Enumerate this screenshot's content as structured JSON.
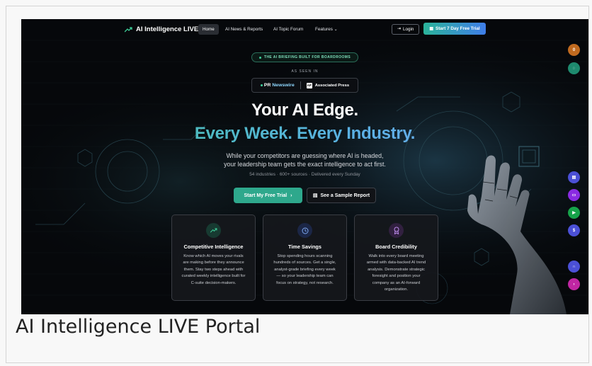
{
  "caption": "AI Intelligence LIVE Portal",
  "nav": {
    "logo": "AI Intelligence LIVE",
    "links": [
      "Home",
      "AI News & Reports",
      "AI Topic Forum",
      "Features"
    ],
    "login": "Login",
    "trial": "Start 7 Day Free Trial"
  },
  "hero": {
    "pill": "THE AI BRIEFING BUILT FOR BOARDROOMS",
    "seen": "AS SEEN IN",
    "press_pr": "PR",
    "press_wire": "Newswire",
    "press_ap_logo": "AP",
    "press_ap": "Associated Press",
    "title1": "Your AI Edge.",
    "title2": "Every Week. Every Industry.",
    "sub1": "While your competitors are guessing where AI is headed,",
    "sub2": "your leadership team gets the exact intelligence to act first.",
    "stats": "54 industries · 600+ sources · Delivered every Sunday",
    "cta_primary": "Start My Free Trial",
    "cta_primary_arrow": "›",
    "cta_secondary": "See a Sample Report"
  },
  "cards": [
    {
      "title": "Competitive Intelligence",
      "lines": [
        "Know which AI moves your rivals",
        "are making before they announce",
        "them. Stay two steps ahead with",
        "curated weekly intelligence built for",
        "C-suite decision-makers."
      ]
    },
    {
      "title": "Time Savings",
      "lines": [
        "Stop spending hours scanning",
        "hundreds of sources. Get a single,",
        "analyst-grade briefing every week",
        "— so your leadership team can",
        "focus on strategy, not research."
      ]
    },
    {
      "title": "Board Credibility",
      "lines": [
        "Walk into every board meeting",
        "armed with data-backed AI trend",
        "analysis. Demonstrate strategic",
        "foresight and position your",
        "company as an AI-forward",
        "organization."
      ]
    }
  ],
  "side_badge": "0",
  "colors": {
    "accent": "#2ea88c",
    "brand_blue": "#3f7de8",
    "bg": "#06080b"
  }
}
